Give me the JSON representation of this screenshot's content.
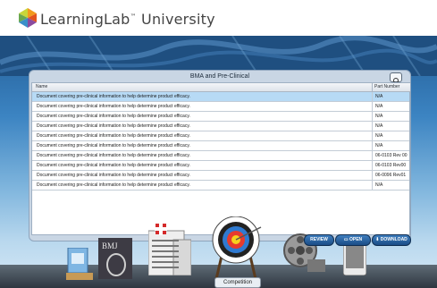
{
  "header": {
    "brand_name": "LearningLab",
    "brand_suffix": "University",
    "trademark": "™"
  },
  "panel": {
    "title": "BMA and Pre-Clinical",
    "columns": {
      "name": "Name",
      "part_number": "Part Number"
    },
    "rows": [
      {
        "name": "Document covering pre-clinical information to help determine product efficacy.",
        "part": "N/A"
      },
      {
        "name": "Document covering pre-clinical information to help determine product efficacy.",
        "part": "N/A"
      },
      {
        "name": "Document covering pre-clinical information to help determine product efficacy.",
        "part": "N/A"
      },
      {
        "name": "Document covering pre-clinical information to help determine product efficacy.",
        "part": "N/A"
      },
      {
        "name": "Document covering pre-clinical information to help determine product efficacy.",
        "part": "N/A"
      },
      {
        "name": "Document covering pre-clinical information to help determine product efficacy.",
        "part": "N/A"
      },
      {
        "name": "Document covering pre-clinical information to help determine product efficacy.",
        "part": "06-0103 Rev 00"
      },
      {
        "name": "Document covering pre-clinical information to help determine product efficacy.",
        "part": "06-0103 Rev00"
      },
      {
        "name": "Document covering pre-clinical information to help determine product efficacy.",
        "part": "06-0096 Rev01"
      },
      {
        "name": "Document covering pre-clinical information to help determine product efficacy.",
        "part": "N/A"
      }
    ],
    "selected_row": 0
  },
  "dock": {
    "preview_label": "REVIEW",
    "open_label": "OPEN",
    "download_label": "DOWNLOAD",
    "active_item_label": "Competition"
  },
  "colors": {
    "selected_row": "#b7daf5",
    "button_blue": "#2f6cae"
  }
}
